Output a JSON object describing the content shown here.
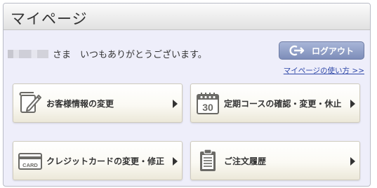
{
  "page": {
    "title": "マイページ"
  },
  "greeting": {
    "name_masked": "",
    "text": "さま　いつもありがとうございます。"
  },
  "logout": {
    "label": "ログアウト",
    "icon": "logout-icon"
  },
  "help_link": {
    "label": "マイページの使い方 >>"
  },
  "menu": [
    {
      "label": "お客様情報の変更",
      "icon": "pen-icon"
    },
    {
      "label": "定期コースの確認・変更・休止",
      "icon": "calendar-icon",
      "icon_text": "30"
    },
    {
      "label": "クレジットカードの変更・修正",
      "icon": "credit-card-icon",
      "icon_text": "CARD"
    },
    {
      "label": "ご注文履歴",
      "icon": "clipboard-icon"
    }
  ],
  "colors": {
    "panel_bg": "#eeeefa",
    "logout_bg": "#8d9cc6",
    "link": "#2e47a8",
    "icon": "#6b6a66"
  }
}
